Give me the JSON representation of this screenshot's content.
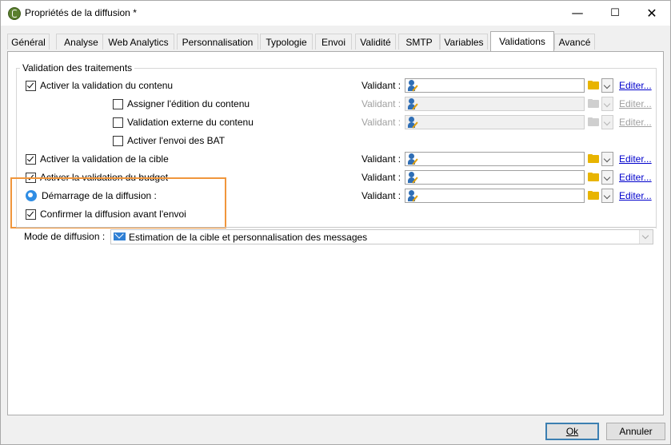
{
  "window": {
    "title": "Propriétés de la diffusion *"
  },
  "tabs": [
    {
      "label": "Général"
    },
    {
      "label": "Analyse"
    },
    {
      "label": "Web Analytics"
    },
    {
      "label": "Personnalisation"
    },
    {
      "label": "Typologie"
    },
    {
      "label": "Envoi"
    },
    {
      "label": "Validité"
    },
    {
      "label": "SMTP"
    },
    {
      "label": "Variables"
    },
    {
      "label": "Validations",
      "active": true
    },
    {
      "label": "Avancé"
    }
  ],
  "validation": {
    "group_label": "Validation des traitements",
    "validant_label": "Validant :",
    "edit_label": "Editer...",
    "rows": [
      {
        "label": "Activer la validation du contenu",
        "checked": true
      },
      {
        "label": "Assigner l'édition du contenu",
        "checked": false
      },
      {
        "label": "Validation externe du contenu",
        "checked": false
      },
      {
        "label": "Activer l'envoi des BAT",
        "checked": false
      },
      {
        "label": "Activer la validation de la cible",
        "checked": true
      },
      {
        "label": "Activer la validation du budget",
        "checked": true
      },
      {
        "label": "Démarrage de la diffusion :"
      },
      {
        "label": "Confirmer la diffusion avant l'envoi",
        "checked": true
      }
    ]
  },
  "mode": {
    "label": "Mode de diffusion :",
    "value": "Estimation de la cible et personnalisation des messages"
  },
  "buttons": {
    "ok": "Ok",
    "cancel": "Annuler"
  },
  "colors": {
    "highlight": "#f0963c",
    "link": "#0000cc"
  }
}
